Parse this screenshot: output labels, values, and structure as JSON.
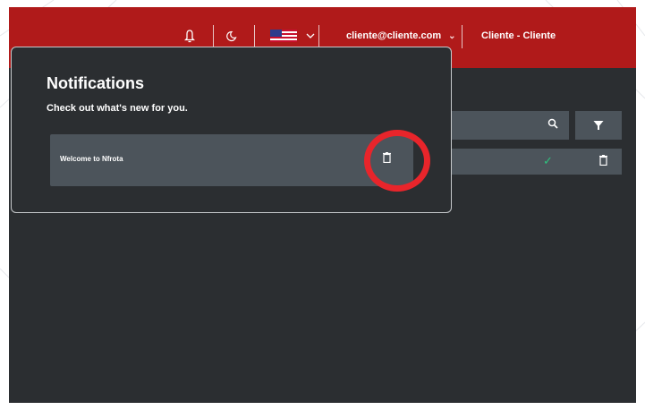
{
  "header": {
    "icons": [
      "bell-icon",
      "moon-icon",
      "us-flag-icon",
      "chevron-down-icon"
    ],
    "user_email": "cliente@cliente.com",
    "client_label": "Cliente - Cliente"
  },
  "notifications": {
    "title": "Notifications",
    "subtitle": "Check out what's new for you.",
    "items": [
      {
        "text": "Welcome to Nfrota"
      }
    ]
  },
  "colors": {
    "brand_red": "#b01a1a",
    "panel_bg": "#2b2e31",
    "item_bg": "#4c545b",
    "highlight_ring": "#e8252b",
    "check_green": "#2ec27e"
  }
}
